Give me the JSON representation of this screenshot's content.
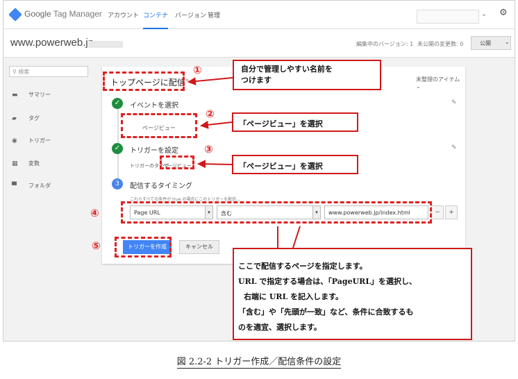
{
  "app": {
    "title_g": "Google",
    "title_rest": "Tag Manager"
  },
  "nav": {
    "items": [
      "アカウント",
      "コンテナ",
      "バージョン",
      "管理"
    ],
    "active_index": 1
  },
  "container": {
    "domain": "www.powerweb.jp",
    "editing_version": "編集中のバージョン: 1",
    "unpublished": "未公開の変更数: 0",
    "publish_label": "公開"
  },
  "sidebar": {
    "search_placeholder": "検索",
    "items": [
      {
        "label": "サマリー",
        "icon": "briefcase-icon"
      },
      {
        "label": "タグ",
        "icon": "tag-icon"
      },
      {
        "label": "トリガー",
        "icon": "trigger-icon"
      },
      {
        "label": "変数",
        "icon": "variables-icon"
      },
      {
        "label": "フォルダ",
        "icon": "folder-icon"
      }
    ]
  },
  "trigger": {
    "name": "トップページに配信",
    "unmanaged": "未整理のアイテム",
    "step1_title": "イベントを選択",
    "step1_value": "ページビュー",
    "step2_title": "トリガーを設定",
    "step2_type_prefix": "トリガーのタイプ",
    "step2_type_value": "ページビュー",
    "step3_number": "3",
    "step3_title": "配信するタイミング",
    "step3_hint": "これらすべての条件が true の場合にこのトリガーを配信...",
    "condition": {
      "variable": "Page URL",
      "operator": "含む",
      "value": "www.powerweb.jp/index.html"
    },
    "create_label": "トリガーを作成",
    "cancel_label": "キャンセル"
  },
  "annotations": {
    "markers": [
      "①",
      "②",
      "③",
      "④",
      "⑤"
    ],
    "callout1_line1": "自分で管理しやすい名前を",
    "callout1_line2": "つけます",
    "callout2": "「ページビュー」を選択",
    "callout3": "「ページビュー」を選択",
    "callout4_lines": [
      "ここで配信するページを指定します。",
      "URL で指定する場合は、「PageURL」を選択し、",
      "右端に URL を記入します。",
      "「含む」や「先頭が一致」など、条件に合致するも",
      "のを適宜、選択します。"
    ]
  },
  "caption": "図 2.2-2 トリガー作成／配信条件の設定",
  "colors": {
    "accent": "#1a73e8",
    "annotation": "#e02020",
    "check": "#1e8e3e"
  }
}
